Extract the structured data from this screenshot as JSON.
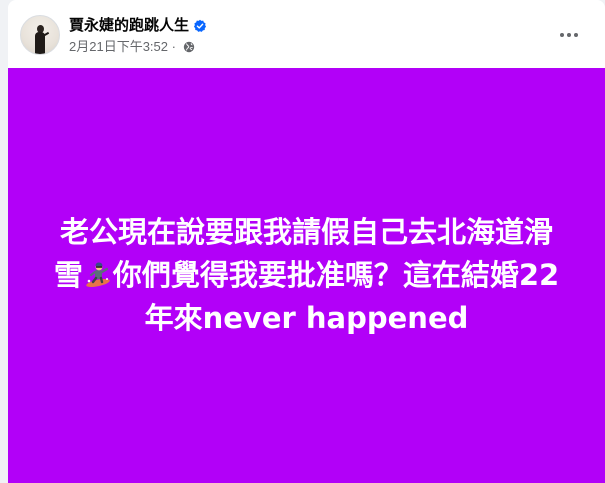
{
  "post": {
    "page_name": "賈永婕的跑跳人生",
    "timestamp": "2月21日下午3:52",
    "meta_separator": " · ",
    "privacy_icon": "globe-icon",
    "verified_icon": "verified-badge-icon",
    "more_icon": "more-options-icon",
    "background_color": "#b200f8",
    "text_part1": "老公現在說要跟我請假自己去北海道滑雪",
    "emoji_icon": "snowboarder-emoji-icon",
    "text_part2": "你們覺得我要批准嗎？這在結婚22年來never happened"
  }
}
